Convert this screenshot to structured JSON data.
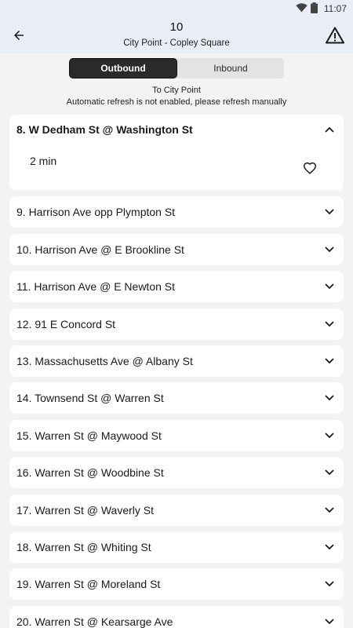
{
  "status_bar": {
    "time": "11:07",
    "icons": [
      "wifi-icon",
      "battery-icon"
    ]
  },
  "header": {
    "route_number": "10",
    "route_name": "City Point - Copley Square"
  },
  "direction_toggle": {
    "options": [
      "Outbound",
      "Inbound"
    ],
    "selected": "Outbound"
  },
  "destination": "To City Point",
  "refresh_notice": "Automatic refresh is not enabled, please refresh manually",
  "expanded_stop": {
    "label": "8. W Dedham St @ Washington St",
    "arrival": "2 min"
  },
  "stops": [
    "9. Harrison Ave opp Plympton St",
    "10. Harrison Ave @ E Brookline St",
    "11. Harrison Ave @ E Newton St",
    "12. 91 E Concord St",
    "13. Massachusetts Ave @ Albany St",
    "14. Townsend St @ Warren St",
    "15. Warren St @ Maywood St",
    "16. Warren St @ Woodbine St",
    "17. Warren St @ Waverly St",
    "18. Warren St @ Whiting St",
    "19. Warren St @ Moreland St",
    "20. Warren St @ Kearsarge Ave"
  ],
  "colors": {
    "header_bg": "#e9eef6",
    "page_bg": "#f3f3f5",
    "toggle_active": "#2a2a2a"
  }
}
